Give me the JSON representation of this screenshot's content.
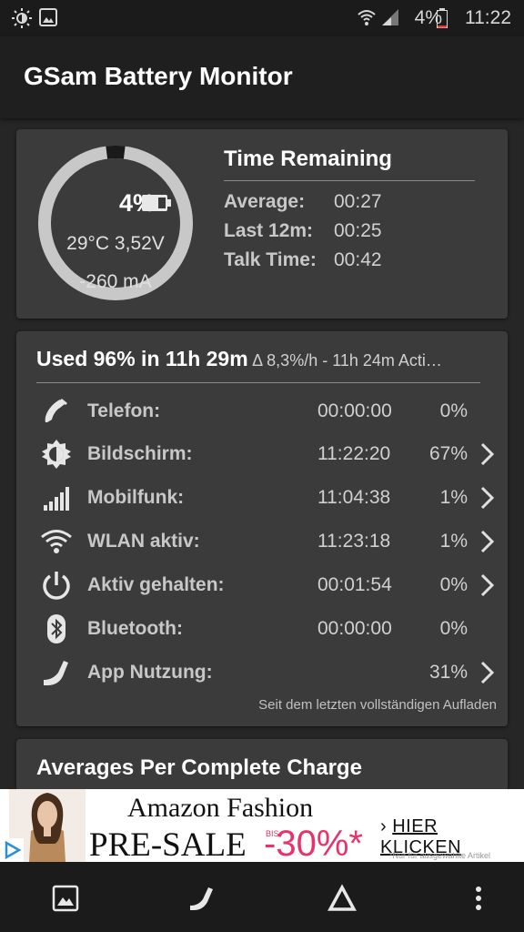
{
  "status_bar": {
    "battery_percent": "4%",
    "time": "11:22",
    "icons": [
      "brightness-icon",
      "gallery-icon",
      "wifi-icon",
      "signal-icon",
      "battery-icon"
    ]
  },
  "app_bar": {
    "title": "GSam Battery Monitor"
  },
  "battery_card": {
    "percent": "4%",
    "level": 0.04,
    "temp_voltage": "29°C  3,52V",
    "current": "-260 mA",
    "time_remaining": {
      "title": "Time Remaining",
      "rows": [
        {
          "label": "Average:",
          "value": "00:27"
        },
        {
          "label": "Last 12m:",
          "value": "00:25"
        },
        {
          "label": "Talk Time:",
          "value": "00:42"
        }
      ]
    }
  },
  "usage_card": {
    "title": "Used 96% in 11h 29m",
    "subtitle": "Δ 8,3%/h - 11h 24m Acti…",
    "rows": [
      {
        "icon": "phone-icon",
        "label": "Telefon:",
        "time": "00:00:00",
        "percent": "0%",
        "has_chevron": false
      },
      {
        "icon": "screen-brightness-icon",
        "label": "Bildschirm:",
        "time": "11:22:20",
        "percent": "67%",
        "has_chevron": true
      },
      {
        "icon": "cell-signal-icon",
        "label": "Mobilfunk:",
        "time": "11:04:38",
        "percent": "1%",
        "has_chevron": true
      },
      {
        "icon": "wifi-icon",
        "label": "WLAN aktiv:",
        "time": "11:23:18",
        "percent": "1%",
        "has_chevron": true
      },
      {
        "icon": "power-icon",
        "label": "Aktiv gehalten:",
        "time": "00:01:54",
        "percent": "0%",
        "has_chevron": true
      },
      {
        "icon": "bluetooth-icon",
        "label": "Bluetooth:",
        "time": "00:00:00",
        "percent": "0%",
        "has_chevron": false
      },
      {
        "icon": "app-usage-icon",
        "label": "App Nutzung:",
        "time": "",
        "percent": "31%",
        "has_chevron": true
      }
    ],
    "footer": "Seit dem letzten vollständigen Aufladen"
  },
  "averages_card": {
    "title": "Averages Per Complete Charge"
  },
  "ad_banner": {
    "brand": "Amazon Fashion",
    "headline": "PRE-SALE",
    "bis": "BIS",
    "discount": "-30%*",
    "cta": "HIER KLICKEN",
    "note": "*Nur für ausgewählte Artikel",
    "colors": {
      "discount": "#e8336a"
    }
  },
  "bottom_nav": {
    "items": [
      "gallery-icon",
      "app-usage-icon",
      "delta-icon",
      "more-vert-icon"
    ]
  },
  "colors": {
    "background": "#262626",
    "card": "#3b3b3b",
    "app_bar": "#1f1f1f",
    "gauge_track": "#c8c8c8",
    "gauge_fill": "#1a1a1a"
  }
}
